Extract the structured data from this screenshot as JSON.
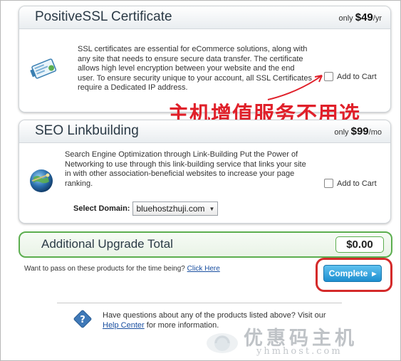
{
  "ssl": {
    "title": "PositiveSSL Certificate",
    "price_prefix": "only",
    "price": "$49",
    "price_unit": "/yr",
    "description": "SSL certificates are essential for eCommerce solutions, along with any site that needs to ensure secure data transfer. The certificate allows high level encryption between your website and the end user. To ensure security unique to your account, all SSL Certificates require a Dedicated IP address.",
    "cart_label": "Add to Cart",
    "cart_checked": false
  },
  "annotation": {
    "text": "主机增值服务不用选",
    "color": "#e0202a"
  },
  "seo": {
    "title": "SEO Linkbuilding",
    "price_prefix": "only",
    "price": "$99",
    "price_unit": "/mo",
    "description": "Search Engine Optimization through Link-Building Put the Power of Networking to use through this link-building service that links your site in with other association-beneficial websites to increase your page ranking.",
    "cart_label": "Add to Cart",
    "cart_checked": false,
    "domain_label": "Select Domain:",
    "domain_value": "bluehostzhuji.com"
  },
  "total": {
    "title": "Additional Upgrade Total",
    "amount": "$0.00"
  },
  "pass": {
    "text": "Want to pass on these products for the time being?",
    "link": "Click Here"
  },
  "complete_button": {
    "label": "Complete"
  },
  "help": {
    "line1": "Have questions about any of the products listed above? Visit our",
    "link": "Help Center",
    "line2_suffix": "for more information."
  },
  "watermark": {
    "chinese": "优惠码主机",
    "english": "yhmhost.com"
  },
  "colors": {
    "accent_green": "#5cae4f",
    "button_blue": "#1d8fd0",
    "annotation_red": "#e0202a",
    "link_blue": "#1a4fa0"
  }
}
